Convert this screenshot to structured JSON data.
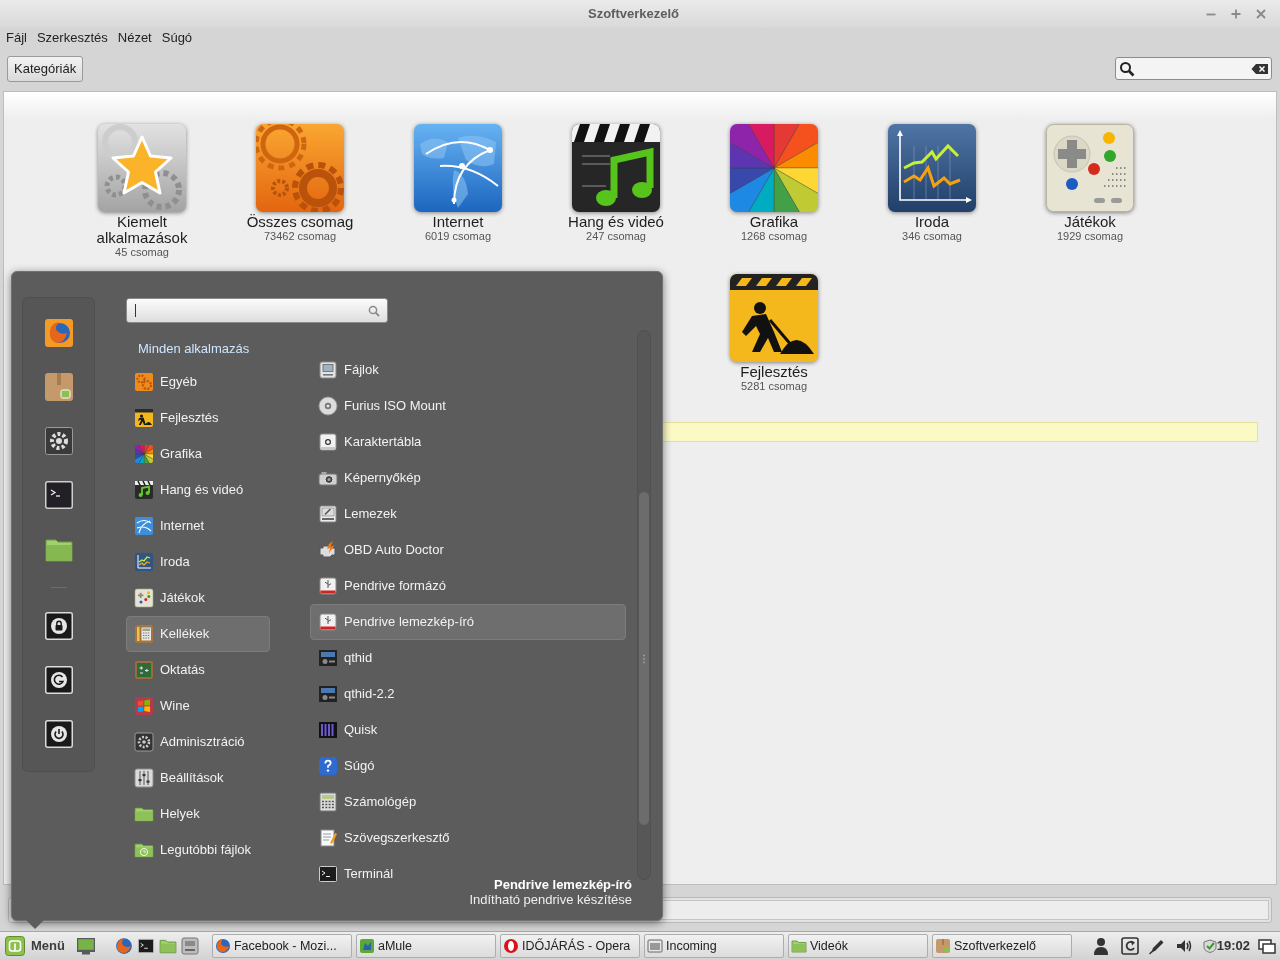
{
  "window": {
    "title": "Szoftverkezelő"
  },
  "menubar": [
    {
      "label": "Fájl"
    },
    {
      "label": "Szerkesztés"
    },
    {
      "label": "Nézet"
    },
    {
      "label": "Súgó"
    }
  ],
  "toolbar": {
    "button": "Kategóriák"
  },
  "categories": [
    {
      "name": "Kiemelt alkalmazások",
      "count": "45 csomag",
      "kind": "featured"
    },
    {
      "name": "Összes csomag",
      "count": "73462 csomag",
      "kind": "all"
    },
    {
      "name": "Internet",
      "count": "6019 csomag",
      "kind": "internet"
    },
    {
      "name": "Hang és videó",
      "count": "247 csomag",
      "kind": "media"
    },
    {
      "name": "Grafika",
      "count": "1268 csomag",
      "kind": "graphics"
    },
    {
      "name": "Iroda",
      "count": "346 csomag",
      "kind": "office"
    },
    {
      "name": "Játékok",
      "count": "1929 csomag",
      "kind": "games"
    },
    {
      "name": "Fejlesztés",
      "count": "5281 csomag",
      "kind": "development"
    }
  ],
  "app_menu": {
    "all_label": "Minden alkalmazás",
    "categories": [
      {
        "name": "Egyéb",
        "kind": "other",
        "selected": false
      },
      {
        "name": "Fejlesztés",
        "kind": "development",
        "selected": false
      },
      {
        "name": "Grafika",
        "kind": "graphics",
        "selected": false
      },
      {
        "name": "Hang és videó",
        "kind": "media",
        "selected": false
      },
      {
        "name": "Internet",
        "kind": "internet",
        "selected": false
      },
      {
        "name": "Iroda",
        "kind": "office",
        "selected": false
      },
      {
        "name": "Játékok",
        "kind": "games",
        "selected": false
      },
      {
        "name": "Kellékek",
        "kind": "accessories",
        "selected": true
      },
      {
        "name": "Oktatás",
        "kind": "education",
        "selected": false
      },
      {
        "name": "Wine",
        "kind": "wine",
        "selected": false
      },
      {
        "name": "Adminisztráció",
        "kind": "admin",
        "selected": false
      },
      {
        "name": "Beállítások",
        "kind": "settings",
        "selected": false
      },
      {
        "name": "Helyek",
        "kind": "places",
        "selected": false
      },
      {
        "name": "Legutóbbi fájlok",
        "kind": "recent",
        "selected": false
      }
    ],
    "apps": [
      {
        "name": "Fájlok",
        "kind": "files",
        "selected": false
      },
      {
        "name": "Furius ISO Mount",
        "kind": "disc",
        "selected": false
      },
      {
        "name": "Karaktertábla",
        "kind": "charmap",
        "selected": false
      },
      {
        "name": "Képernyőkép",
        "kind": "camera",
        "selected": false
      },
      {
        "name": "Lemezek",
        "kind": "disks",
        "selected": false
      },
      {
        "name": "OBD Auto Doctor",
        "kind": "engine",
        "selected": false
      },
      {
        "name": "Pendrive formázó",
        "kind": "usb",
        "selected": false
      },
      {
        "name": "Pendrive lemezkép-író",
        "kind": "usb",
        "selected": true
      },
      {
        "name": "qthid",
        "kind": "radio",
        "selected": false
      },
      {
        "name": "qthid-2.2",
        "kind": "radio",
        "selected": false
      },
      {
        "name": "Quisk",
        "kind": "spectrum",
        "selected": false
      },
      {
        "name": "Súgó",
        "kind": "help",
        "selected": false
      },
      {
        "name": "Számológép",
        "kind": "calculator",
        "selected": false
      },
      {
        "name": "Szövegszerkesztő",
        "kind": "editor",
        "selected": false
      },
      {
        "name": "Terminál",
        "kind": "terminal",
        "selected": false
      }
    ],
    "description": {
      "title": "Pendrive lemezkép-író",
      "text": "Indítható pendrive készítése"
    }
  },
  "taskbar": {
    "menu_label": "Menü",
    "tasks": [
      {
        "title": "Facebook - Mozi...",
        "kind": "globe"
      },
      {
        "title": "aMule",
        "kind": "mule"
      },
      {
        "title": "IDŐJÁRÁS - Opera",
        "kind": "ring"
      },
      {
        "title": "Incoming",
        "kind": "window"
      },
      {
        "title": "Videók",
        "kind": "folder"
      },
      {
        "title": "Szoftverkezelő",
        "kind": "package"
      }
    ],
    "clock": "19:02"
  }
}
